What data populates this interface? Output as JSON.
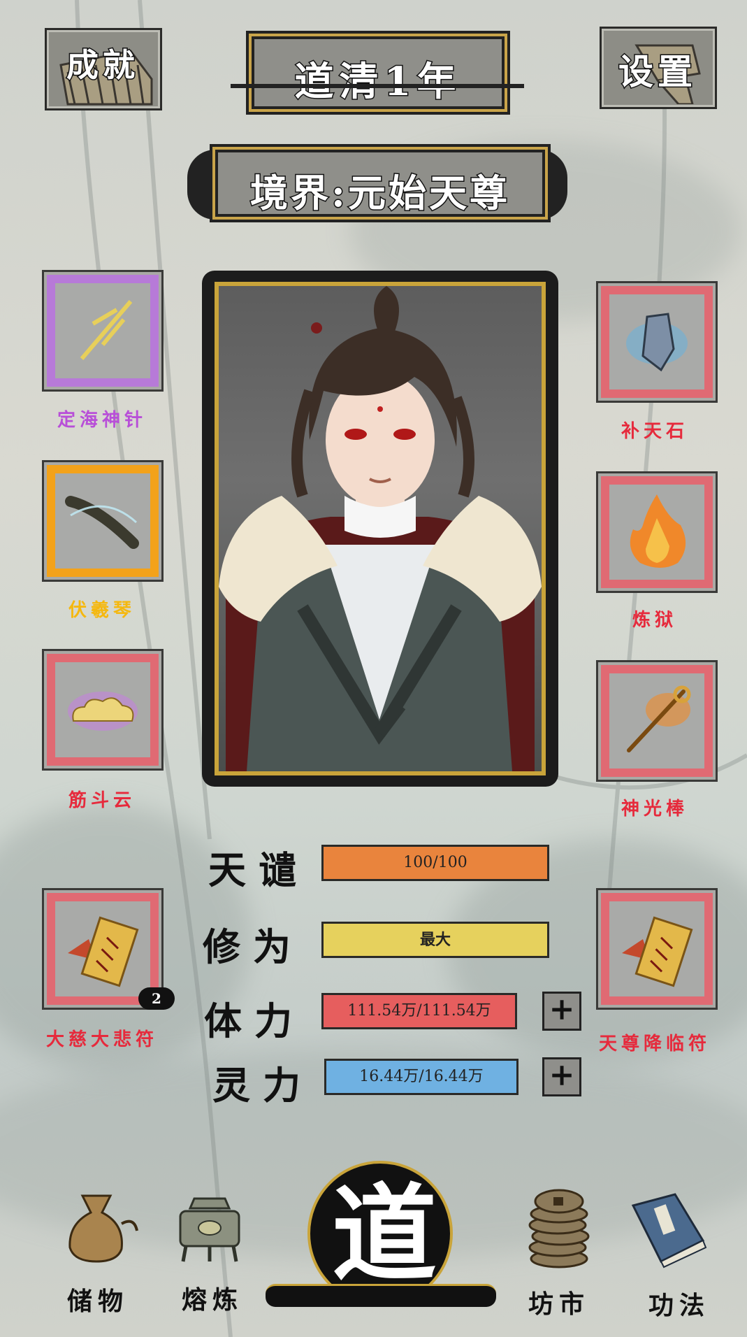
{
  "header": {
    "achievements_label": "成就",
    "year_label": "道清1年",
    "settings_label": "设置"
  },
  "realm": {
    "label": "境界:元始天尊"
  },
  "left_items": [
    {
      "name": "定海神针",
      "color": "#b84fd8",
      "frame": "purple",
      "icon": "trident-icon"
    },
    {
      "name": "伏羲琴",
      "color": "#f5b80f",
      "frame": "orange",
      "icon": "zither-icon"
    },
    {
      "name": "筋斗云",
      "color": "#e62a3c",
      "frame": "red",
      "icon": "cloud-icon"
    },
    {
      "name": "大慈大悲符",
      "color": "#e62a3c",
      "frame": "red",
      "icon": "talisman-icon",
      "count": "2"
    }
  ],
  "right_items": [
    {
      "name": "补天石",
      "color": "#e62a3c",
      "frame": "red",
      "icon": "crystal-icon"
    },
    {
      "name": "炼狱",
      "color": "#e62a3c",
      "frame": "red",
      "icon": "flame-icon"
    },
    {
      "name": "神光棒",
      "color": "#e62a3c",
      "frame": "red",
      "icon": "staff-icon"
    },
    {
      "name": "天尊降临符",
      "color": "#e62a3c",
      "frame": "red",
      "icon": "talisman-icon"
    }
  ],
  "stats": [
    {
      "label": "天谴",
      "value": "100/100",
      "fill_color": "#e9843d",
      "fill": 1.0,
      "has_plus": false
    },
    {
      "label": "修为",
      "value": "最大",
      "fill_color": "#e6d15d",
      "fill": 1.0,
      "has_plus": false
    },
    {
      "label": "体力",
      "value": "111.54万/111.54万",
      "fill_color": "#e65e5e",
      "fill": 1.0,
      "has_plus": true
    },
    {
      "label": "灵力",
      "value": "16.44万/16.44万",
      "fill_color": "#6fb1e2",
      "fill": 1.0,
      "has_plus": true
    }
  ],
  "nav": {
    "storage_label": "储物",
    "smelt_label": "熔炼",
    "dao_label": "道",
    "market_label": "坊市",
    "skills_label": "功法"
  },
  "colors": {
    "accent_gold": "#c9a43a",
    "ink": "#111111"
  }
}
